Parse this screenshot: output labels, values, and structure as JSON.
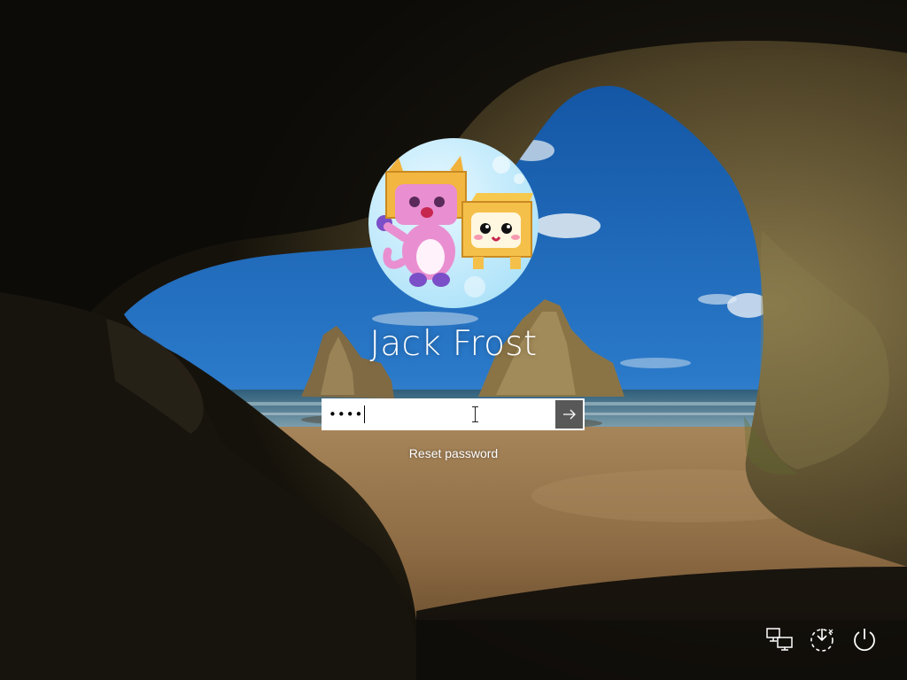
{
  "login": {
    "user_name": "Jack Frost",
    "password_masked": "••••",
    "reset_password_label": "Reset password"
  },
  "icons": {
    "submit": "arrow-right-icon",
    "network": "network-icon",
    "accessibility": "ease-of-access-icon",
    "power": "power-icon"
  },
  "colors": {
    "text": "#ffffff",
    "submit_button": "#585858"
  }
}
